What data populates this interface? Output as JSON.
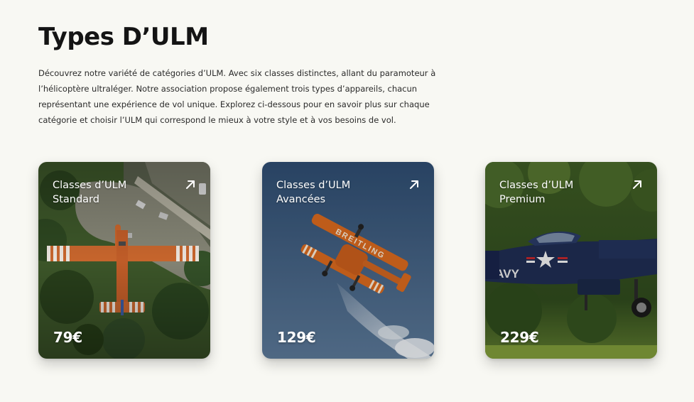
{
  "header": {
    "title": "Types D’ULM",
    "description": "Découvrez notre variété de catégories d’ULM. Avec six classes distinctes, allant du paramoteur à l’hélicoptère ultraléger. Notre association propose également trois types d’appareils, chacun représentant une expérience de vol unique. Explorez ci-dessous pour en savoir plus sur chaque catégorie et choisir l’ULM qui correspond le mieux à votre style et à vos besoins de vol."
  },
  "cards": [
    {
      "title_line1": "Classes d’ULM",
      "title_line2": "Standard",
      "price": "79€",
      "icon": "arrow-up-right-icon",
      "banner_text": ""
    },
    {
      "title_line1": "Classes d’ULM",
      "title_line2": "Avancées",
      "price": "129€",
      "icon": "arrow-up-right-icon",
      "banner_text": "BREITLING"
    },
    {
      "title_line1": "Classes d’ULM",
      "title_line2": "Premium",
      "price": "229€",
      "icon": "arrow-up-right-icon",
      "banner_text": "NAVY"
    }
  ],
  "colors": {
    "background": "#f8f8f3",
    "text": "#141414",
    "card_text": "#ffffff"
  }
}
